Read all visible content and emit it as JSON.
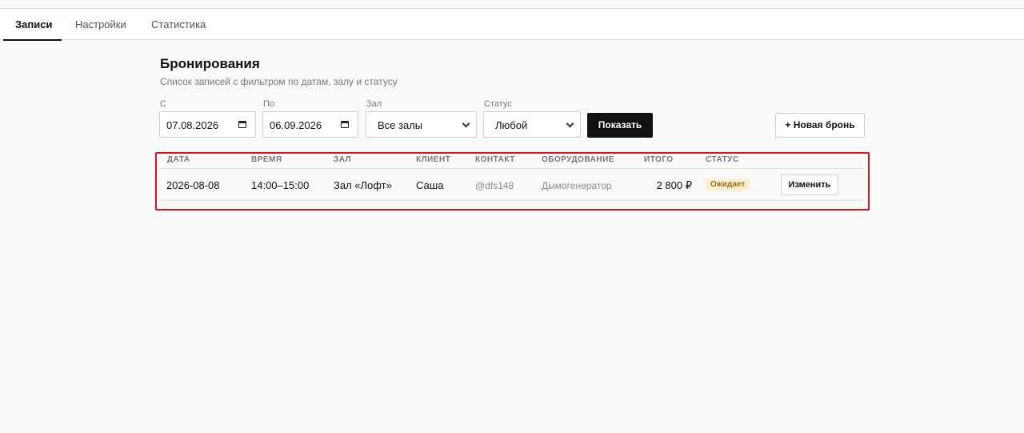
{
  "tabs": [
    {
      "label": "Записи",
      "active": true
    },
    {
      "label": "Настройки",
      "active": false
    },
    {
      "label": "Статистика",
      "active": false
    }
  ],
  "page": {
    "title": "Бронирования",
    "subtitle": "Список записей с фильтром по датам, залу и статусу"
  },
  "filters": {
    "from": {
      "label": "С",
      "value": "07.08.2026",
      "icon": "calendar-icon"
    },
    "to": {
      "label": "По",
      "value": "06.09.2026",
      "icon": "calendar-icon"
    },
    "hall": {
      "label": "Зал",
      "value": "Все залы",
      "icon": "chevron-down-icon"
    },
    "status": {
      "label": "Статус",
      "value": "Любой",
      "icon": "chevron-down-icon"
    },
    "show_label": "Показать",
    "new_label": "+ Новая бронь"
  },
  "table": {
    "columns": [
      "ДАТА",
      "ВРЕМЯ",
      "ЗАЛ",
      "КЛИЕНТ",
      "КОНТАКТ",
      "ОБОРУДОВАНИЕ",
      "ИТОГО",
      "СТАТУС"
    ],
    "rows": [
      {
        "date": "2026-08-08",
        "time": "14:00–15:00",
        "hall": "Зал «Лофт»",
        "client": "Саша",
        "contact": "@dfs148",
        "equipment": "Дымогенератор",
        "total": "2 800 ₽",
        "status": "Ожидает",
        "edit_label": "Изменить"
      }
    ]
  },
  "colors": {
    "accent": "#111111",
    "highlight_border": "#e0101a",
    "status_badge_bg": "#fbf0d6",
    "status_badge_text": "#9a6b12"
  }
}
